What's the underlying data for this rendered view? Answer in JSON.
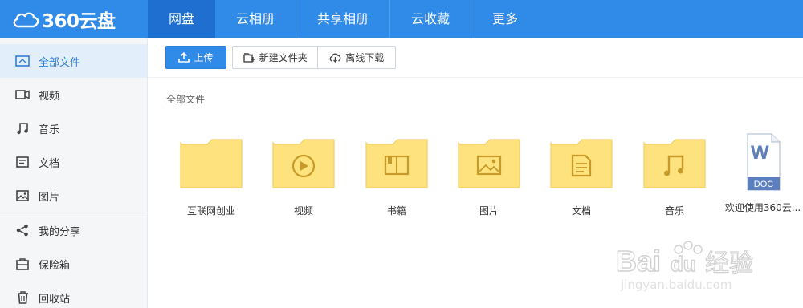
{
  "brand": {
    "name": "360云盘"
  },
  "nav": [
    "网盘",
    "云相册",
    "共享相册",
    "云收藏",
    "更多"
  ],
  "sidebar": [
    {
      "label": "全部文件",
      "icon": "all-files-icon"
    },
    {
      "label": "视频",
      "icon": "video-icon"
    },
    {
      "label": "音乐",
      "icon": "music-icon"
    },
    {
      "label": "文档",
      "icon": "document-icon"
    },
    {
      "label": "图片",
      "icon": "image-icon"
    },
    {
      "label": "我的分享",
      "icon": "share-icon"
    },
    {
      "label": "保险箱",
      "icon": "safe-icon"
    },
    {
      "label": "回收站",
      "icon": "trash-icon"
    }
  ],
  "toolbar": {
    "upload": "上传",
    "new_folder": "新建文件夹",
    "offline_download": "离线下载"
  },
  "breadcrumb": "全部文件",
  "files": [
    {
      "name": "互联网创业",
      "type": "folder"
    },
    {
      "name": "视频",
      "type": "folder-video"
    },
    {
      "name": "书籍",
      "type": "folder-book"
    },
    {
      "name": "图片",
      "type": "folder-image"
    },
    {
      "name": "文档",
      "type": "folder-document"
    },
    {
      "name": "音乐",
      "type": "folder-music"
    },
    {
      "name": "欢迎使用360云...",
      "type": "doc",
      "badge": "DOC"
    }
  ],
  "watermark": {
    "line1": "Bai",
    "line2": "du",
    "line3": "经验",
    "url": "jingyan.baidu.com"
  },
  "colors": {
    "primary": "#2f8ae8",
    "folder": "#fde27d",
    "folder_tab": "#f8d568"
  }
}
